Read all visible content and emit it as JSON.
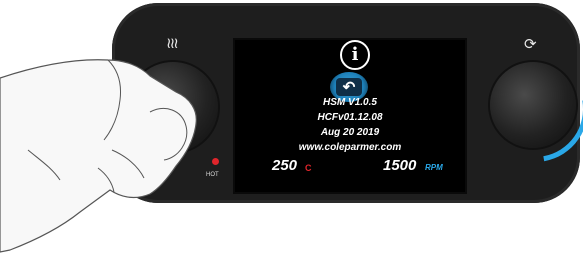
{
  "device": {
    "heat_icon": "heat-waves-icon",
    "stir_icon": "rotate-icon",
    "hot_label": "HOT"
  },
  "screen": {
    "info_icon": "info-icon",
    "back_icon": "back-arrow-icon",
    "lines": [
      "HSM V1.0.5",
      "HCFv01.12.08",
      "Aug 20 2019",
      "www.coleparmer.com"
    ],
    "temperature": "250",
    "temperature_unit": "C",
    "speed": "1500",
    "speed_unit": "RPM"
  },
  "colors": {
    "panel": "#1e1e1e",
    "heat_accent": "#e0252b",
    "stir_accent": "#2aa8e8",
    "screen_bg": "#000000"
  }
}
